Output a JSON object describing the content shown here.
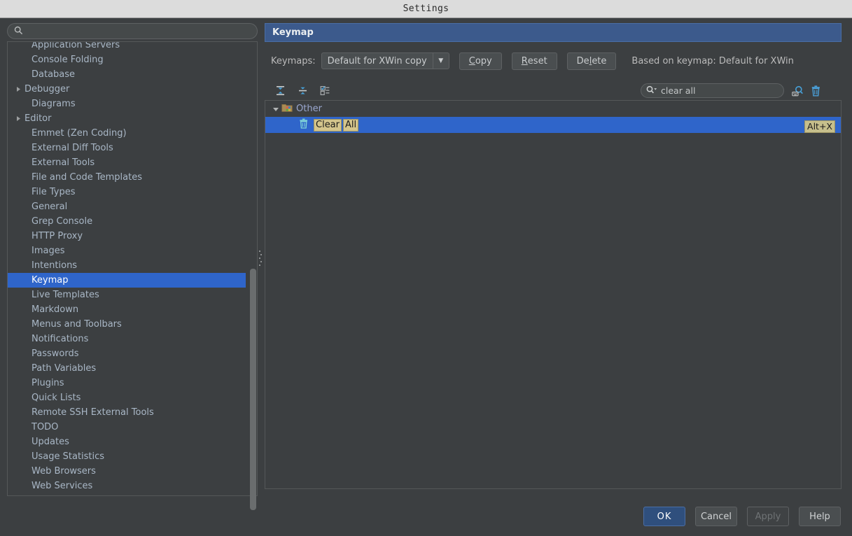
{
  "window": {
    "title": "Settings"
  },
  "sidebar": {
    "search": {
      "value": "",
      "placeholder": "",
      "icon": "search-icon"
    },
    "items": [
      {
        "label": "Application Servers",
        "expandable": false,
        "selected": false
      },
      {
        "label": "Console Folding",
        "expandable": false,
        "selected": false
      },
      {
        "label": "Database",
        "expandable": false,
        "selected": false
      },
      {
        "label": "Debugger",
        "expandable": true,
        "selected": false
      },
      {
        "label": "Diagrams",
        "expandable": false,
        "selected": false
      },
      {
        "label": "Editor",
        "expandable": true,
        "selected": false
      },
      {
        "label": "Emmet (Zen Coding)",
        "expandable": false,
        "selected": false
      },
      {
        "label": "External Diff Tools",
        "expandable": false,
        "selected": false
      },
      {
        "label": "External Tools",
        "expandable": false,
        "selected": false
      },
      {
        "label": "File and Code Templates",
        "expandable": false,
        "selected": false
      },
      {
        "label": "File Types",
        "expandable": false,
        "selected": false
      },
      {
        "label": "General",
        "expandable": false,
        "selected": false
      },
      {
        "label": "Grep Console",
        "expandable": false,
        "selected": false
      },
      {
        "label": "HTTP Proxy",
        "expandable": false,
        "selected": false
      },
      {
        "label": "Images",
        "expandable": false,
        "selected": false
      },
      {
        "label": "Intentions",
        "expandable": false,
        "selected": false
      },
      {
        "label": "Keymap",
        "expandable": false,
        "selected": true
      },
      {
        "label": "Live Templates",
        "expandable": false,
        "selected": false
      },
      {
        "label": "Markdown",
        "expandable": false,
        "selected": false
      },
      {
        "label": "Menus and Toolbars",
        "expandable": false,
        "selected": false
      },
      {
        "label": "Notifications",
        "expandable": false,
        "selected": false
      },
      {
        "label": "Passwords",
        "expandable": false,
        "selected": false
      },
      {
        "label": "Path Variables",
        "expandable": false,
        "selected": false
      },
      {
        "label": "Plugins",
        "expandable": false,
        "selected": false
      },
      {
        "label": "Quick Lists",
        "expandable": false,
        "selected": false
      },
      {
        "label": "Remote SSH External Tools",
        "expandable": false,
        "selected": false
      },
      {
        "label": "TODO",
        "expandable": false,
        "selected": false
      },
      {
        "label": "Updates",
        "expandable": false,
        "selected": false
      },
      {
        "label": "Usage Statistics",
        "expandable": false,
        "selected": false
      },
      {
        "label": "Web Browsers",
        "expandable": false,
        "selected": false
      },
      {
        "label": "Web Services",
        "expandable": false,
        "selected": false
      }
    ]
  },
  "panel": {
    "title": "Keymap",
    "keymaps_label": "Keymaps:",
    "keymap_selected": "Default for XWin copy",
    "buttons": {
      "copy": {
        "pre": "",
        "mnemonic": "C",
        "post": "opy"
      },
      "reset": {
        "pre": "",
        "mnemonic": "R",
        "post": "eset"
      },
      "delete": {
        "pre": "De",
        "mnemonic": "l",
        "post": "ete"
      }
    },
    "based_on": "Based on keymap: Default for XWin",
    "toolbar_icons": [
      "expand-all-icon",
      "collapse-all-icon",
      "show-conflicts-icon"
    ],
    "find": {
      "value": "clear all",
      "icon": "search-dropdown-icon"
    },
    "right_icons": [
      "find-by-shortcut-icon",
      "clear-shortcut-icon"
    ],
    "tree": {
      "group": {
        "label": "Other",
        "icon": "folder-icon",
        "expanded": true
      },
      "rows": [
        {
          "icon": "trash-icon",
          "text_parts": [
            "Clear",
            "All"
          ],
          "shortcut": "Alt+X",
          "selected": true
        }
      ]
    }
  },
  "footer": {
    "ok": "OK",
    "cancel": "Cancel",
    "apply": "Apply",
    "help": "Help"
  },
  "colors": {
    "accent_blue": "#2f65ca",
    "header_blue": "#3c5a8c",
    "background": "#3c3f41",
    "text": "#a9b7c6",
    "highlight_tan": "#d4c58c"
  }
}
